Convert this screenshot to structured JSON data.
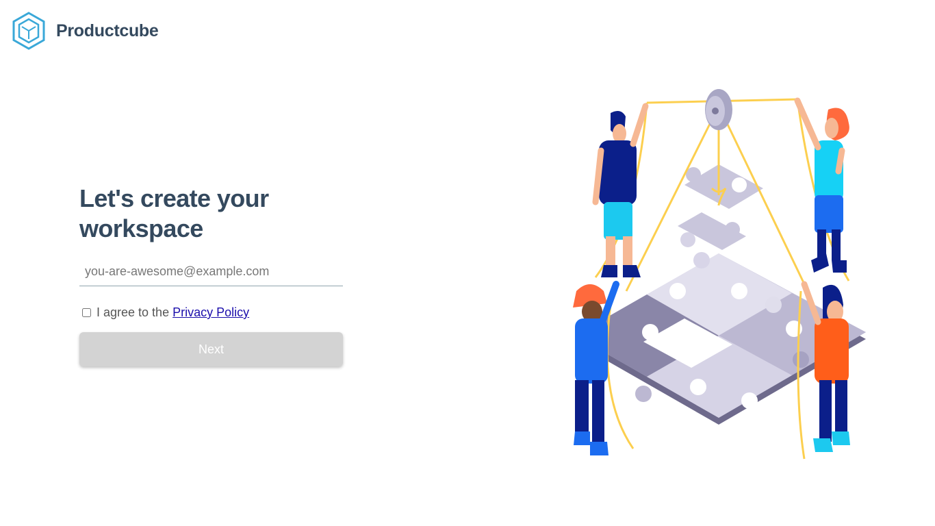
{
  "brand": {
    "name": "Productcube",
    "logo_icon": "hexagon-cube-icon"
  },
  "form": {
    "title": "Let's create your workspace",
    "email_placeholder": "you-are-awesome@example.com",
    "email_value": "",
    "agree_text": "I agree to the",
    "privacy_link": "Privacy Policy",
    "agree_checked": false,
    "next_label": "Next",
    "next_enabled": false
  },
  "illustration": {
    "name": "team-puzzle-illustration"
  },
  "colors": {
    "heading": "#34495e",
    "logo_blue": "#3aa8d8",
    "link": "#1a0dab",
    "button_disabled": "#d3d3d3"
  }
}
